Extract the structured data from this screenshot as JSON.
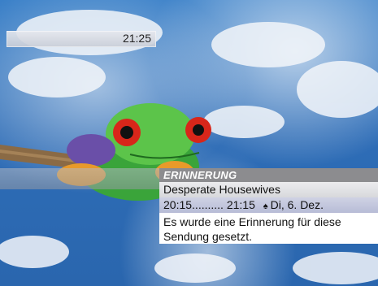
{
  "clock": {
    "time": "21:25"
  },
  "reminder": {
    "title": "ERINNERUNG",
    "show": "Desperate Housewives",
    "start": "20:15",
    "dots": "..........",
    "end": "21:15",
    "date": "Di, 6. Dez.",
    "message_line1": "Es wurde eine Erinnerung für diese",
    "message_line2": "Sendung gesetzt."
  }
}
